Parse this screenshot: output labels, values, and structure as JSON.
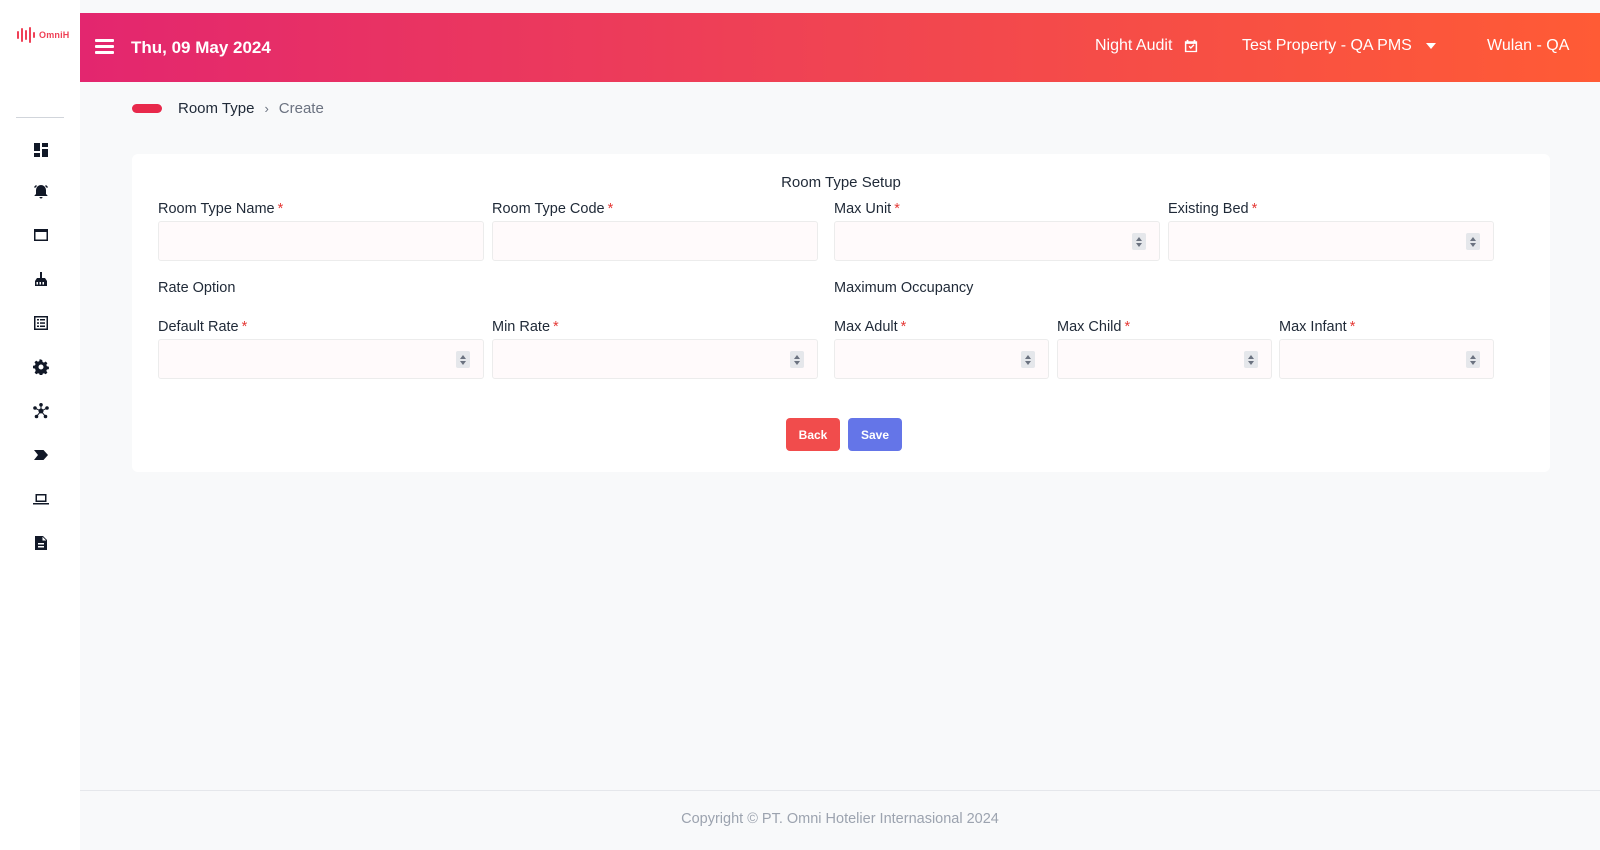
{
  "app": {
    "logo_text": "OmniH"
  },
  "header": {
    "date": "Thu, 09 May 2024",
    "night_audit_label": "Night Audit",
    "property_label": "Test Property - QA PMS",
    "user_label": "Wulan - QA",
    "gradient_colors": [
      "#e3266f",
      "#f04452",
      "#ff5b35"
    ]
  },
  "sidebar": {
    "items": [
      {
        "icon": "dashboard-icon"
      },
      {
        "icon": "alarm-icon"
      },
      {
        "icon": "window-icon"
      },
      {
        "icon": "housekeeping-icon"
      },
      {
        "icon": "list-icon"
      },
      {
        "icon": "settings-icon"
      },
      {
        "icon": "network-icon"
      },
      {
        "icon": "label-icon"
      },
      {
        "icon": "laptop-icon"
      },
      {
        "icon": "report-icon"
      }
    ]
  },
  "breadcrumb": {
    "parent": "Room Type",
    "separator": "›",
    "current": "Create"
  },
  "form": {
    "title": "Room Type Setup",
    "required_marker": "*",
    "room_type_name": {
      "label": "Room Type Name",
      "value": ""
    },
    "room_type_code": {
      "label": "Room Type Code",
      "value": ""
    },
    "max_unit": {
      "label": "Max Unit",
      "value": ""
    },
    "existing_bed": {
      "label": "Existing Bed",
      "value": ""
    },
    "rate_option_title": "Rate Option",
    "max_occupancy_title": "Maximum Occupancy",
    "default_rate": {
      "label": "Default Rate",
      "value": ""
    },
    "min_rate": {
      "label": "Min Rate",
      "value": ""
    },
    "max_adult": {
      "label": "Max Adult",
      "value": ""
    },
    "max_child": {
      "label": "Max Child",
      "value": ""
    },
    "max_infant": {
      "label": "Max Infant",
      "value": ""
    },
    "back_label": "Back",
    "save_label": "Save"
  },
  "colors": {
    "accent": "#e8294b",
    "back_button": "#f14c4c",
    "save_button": "#6475e8"
  },
  "footer": {
    "copyright": "Copyright © PT. Omni Hotelier Internasional 2024"
  }
}
